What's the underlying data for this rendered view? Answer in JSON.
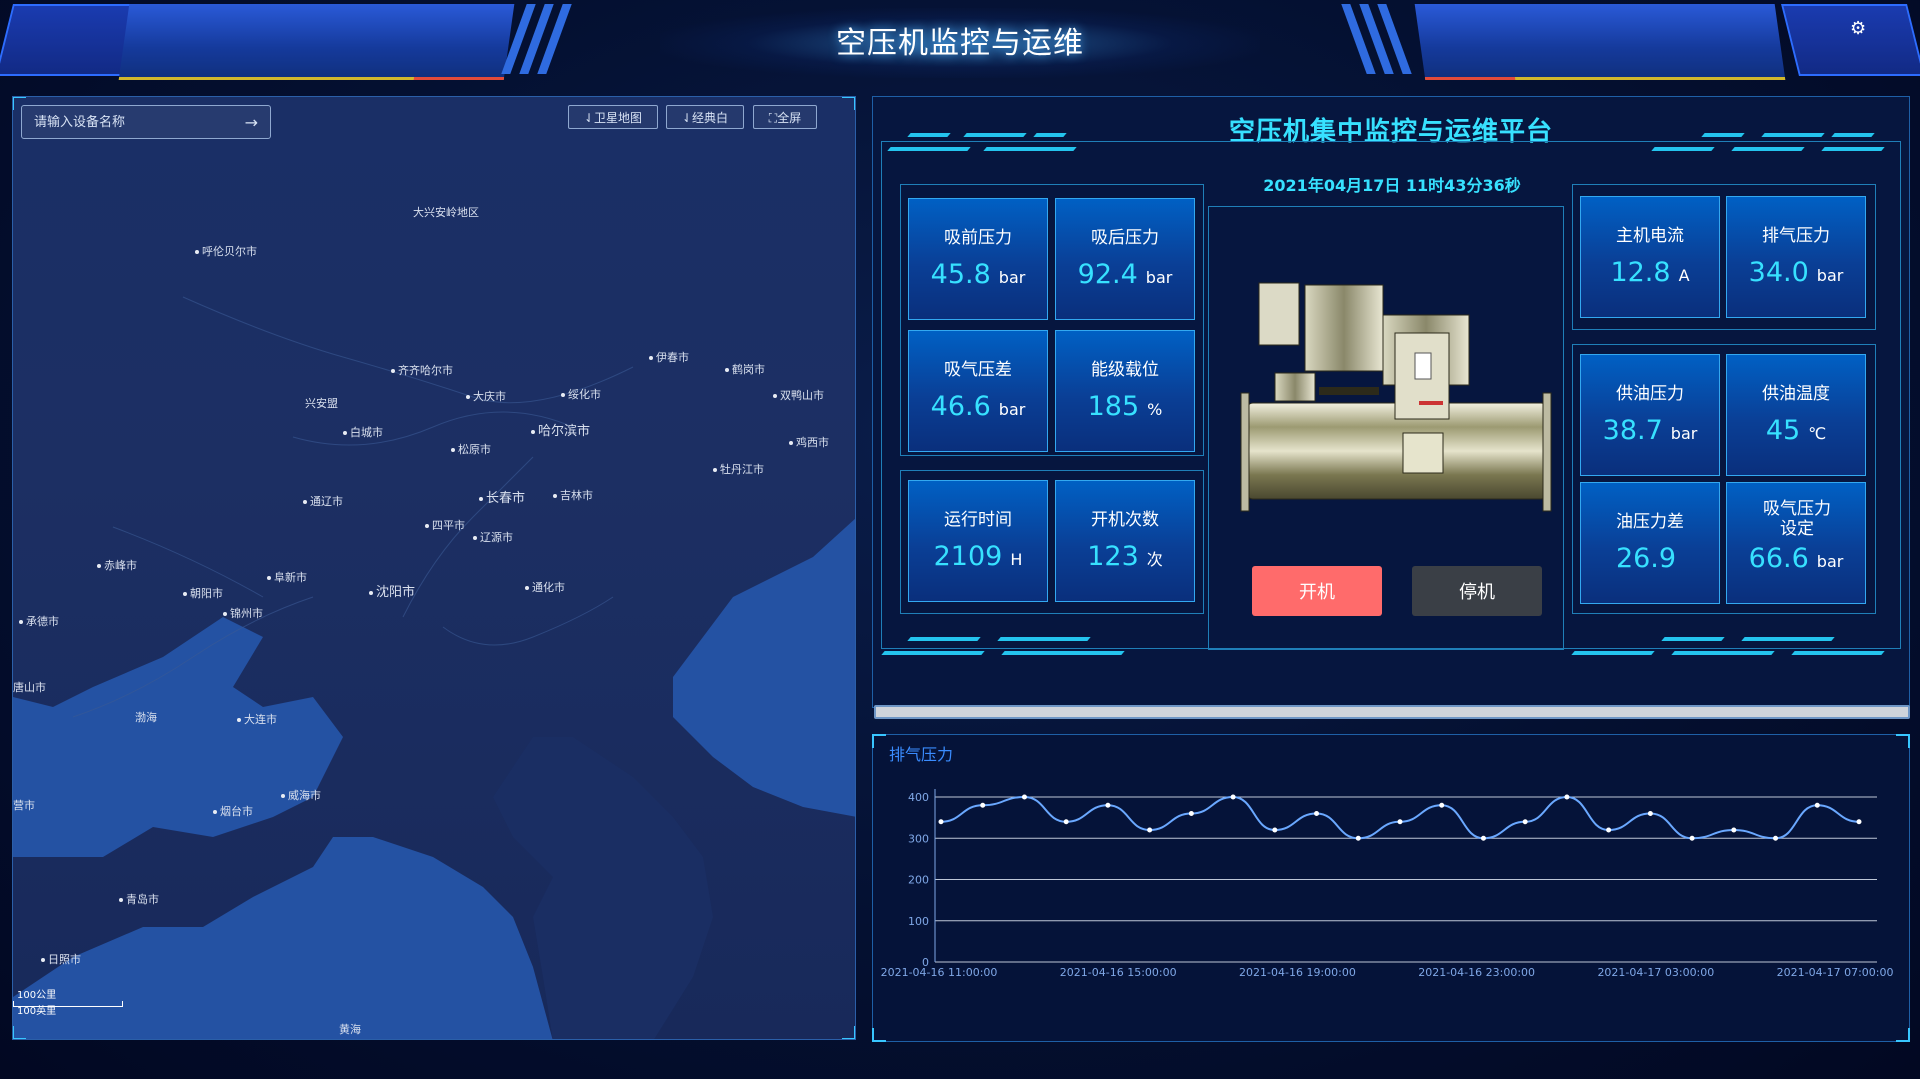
{
  "header": {
    "title": "空压机监控与运维"
  },
  "map": {
    "search_placeholder": "请输入设备名称",
    "buttons": [
      "⇃卫星地图",
      "⇃经典白",
      "⛶全屏"
    ],
    "cities": [
      {
        "name": "大兴安岭地区",
        "dot": false
      },
      {
        "name": "呼伦贝尔市",
        "dot": true
      },
      {
        "name": "齐齐哈尔市",
        "dot": true
      },
      {
        "name": "伊春市",
        "dot": true
      },
      {
        "name": "鹤岗市",
        "dot": true
      },
      {
        "name": "大庆市",
        "dot": true
      },
      {
        "name": "绥化市",
        "dot": true
      },
      {
        "name": "双鸭山市",
        "dot": true
      },
      {
        "name": "兴安盟",
        "dot": false
      },
      {
        "name": "白城市",
        "dot": true
      },
      {
        "name": "哈尔滨市",
        "dot": true
      },
      {
        "name": "松原市",
        "dot": true
      },
      {
        "name": "鸡西市",
        "dot": true
      },
      {
        "name": "牡丹江市",
        "dot": true
      },
      {
        "name": "通辽市",
        "dot": true
      },
      {
        "name": "长春市",
        "dot": true
      },
      {
        "name": "吉林市",
        "dot": true
      },
      {
        "name": "四平市",
        "dot": true
      },
      {
        "name": "辽源市",
        "dot": true
      },
      {
        "name": "赤峰市",
        "dot": true
      },
      {
        "name": "阜新市",
        "dot": true
      },
      {
        "name": "沈阳市",
        "dot": true
      },
      {
        "name": "通化市",
        "dot": true
      },
      {
        "name": "朝阳市",
        "dot": true
      },
      {
        "name": "锦州市",
        "dot": true
      },
      {
        "name": "承德市",
        "dot": true
      },
      {
        "name": "唐山市",
        "dot": true
      },
      {
        "name": "渤海",
        "dot": false
      },
      {
        "name": "大连市",
        "dot": true
      },
      {
        "name": "营市",
        "dot": true
      },
      {
        "name": "烟台市",
        "dot": true
      },
      {
        "name": "威海市",
        "dot": true
      },
      {
        "name": "青岛市",
        "dot": true
      },
      {
        "name": "日照市",
        "dot": true
      },
      {
        "name": "黄海",
        "dot": false
      }
    ],
    "scale_km": "100公里",
    "scale_mi": "100英里"
  },
  "monitor": {
    "title": "空压机集中监控与运维平台",
    "datetime": "2021年04月17日 11时43分36秒",
    "cards": [
      {
        "label": "吸前压力",
        "value": "45.8",
        "unit": "bar"
      },
      {
        "label": "吸后压力",
        "value": "92.4",
        "unit": "bar"
      },
      {
        "label": "吸气压差",
        "value": "46.6",
        "unit": "bar"
      },
      {
        "label": "能级载位",
        "value": "185",
        "unit": "%"
      },
      {
        "label": "运行时间",
        "value": "2109",
        "unit": "H"
      },
      {
        "label": "开机次数",
        "value": "123",
        "unit": "次"
      },
      {
        "label": "主机电流",
        "value": "12.8",
        "unit": "A"
      },
      {
        "label": "排气压力",
        "value": "34.0",
        "unit": "bar"
      },
      {
        "label": "供油压力",
        "value": "38.7",
        "unit": "bar"
      },
      {
        "label": "供油温度",
        "value": "45",
        "unit": "℃"
      },
      {
        "label": "油压力差",
        "value": "26.9",
        "unit": ""
      },
      {
        "label": "吸气压力设定",
        "value": "66.6",
        "unit": "bar"
      }
    ],
    "start_label": "开机",
    "stop_label": "停机"
  },
  "chart_data": {
    "type": "line",
    "title": "排气压力",
    "ylim": [
      0,
      400
    ],
    "yticks": [
      0,
      100,
      200,
      300,
      400
    ],
    "xtick_labels": [
      "2021-04-16 11:00:00",
      "2021-04-16 15:00:00",
      "2021-04-16 19:00:00",
      "2021-04-16 23:00:00",
      "2021-04-17 03:00:00",
      "2021-04-17 07:00:00"
    ],
    "series": [
      {
        "values": [
          340,
          380,
          400,
          340,
          380,
          320,
          360,
          400,
          320,
          360,
          300,
          340,
          380,
          300,
          340,
          400,
          320,
          360,
          300,
          320,
          300,
          380,
          340
        ]
      }
    ],
    "grid": true,
    "colors": {
      "line": "#6aa8ff",
      "grid": "#dfe7f3",
      "axis_text": "#7fa7e6"
    }
  }
}
